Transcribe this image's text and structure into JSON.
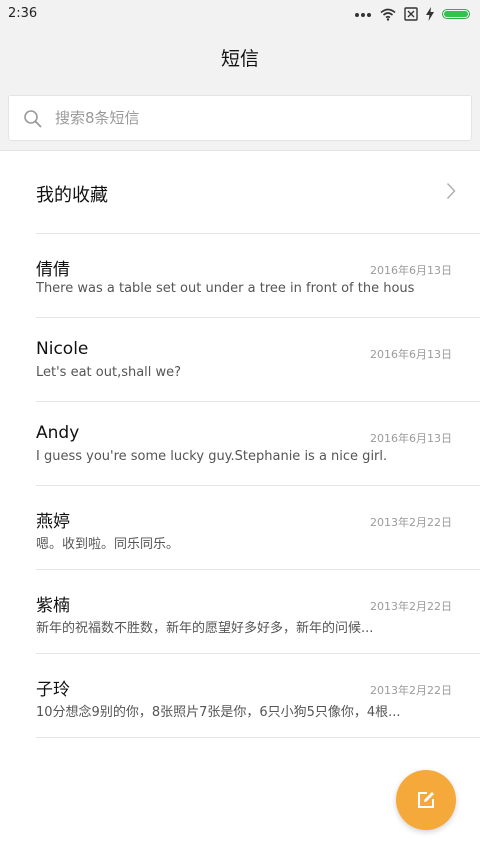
{
  "status_bar": {
    "time": "2:36"
  },
  "header": {
    "title": "短信"
  },
  "search": {
    "placeholder": "搜索8条短信"
  },
  "favorites": {
    "label": "我的收藏"
  },
  "conversations": [
    {
      "name": "倩倩",
      "date": "2016年6月13日",
      "preview": "There was a table set out under a tree in front of the hous"
    },
    {
      "name": "Nicole",
      "date": "2016年6月13日",
      "preview": "Let's eat out,shall we?"
    },
    {
      "name": "Andy",
      "date": "2016年6月13日",
      "preview": "I guess you're some lucky guy.Stephanie is a nice girl."
    },
    {
      "name": "燕婷",
      "date": "2013年2月22日",
      "preview": "嗯。收到啦。同乐同乐。"
    },
    {
      "name": "紫楠",
      "date": "2013年2月22日",
      "preview": "新年的祝福数不胜数，新年的愿望好多好多，新年的问候..."
    },
    {
      "name": "子玲",
      "date": "2013年2月22日",
      "preview": "10分想念9别的你，8张照片7张是你，6只小狗5只像你，4根..."
    }
  ],
  "colors": {
    "accent": "#f5a93a",
    "battery": "#33c24f"
  },
  "icons": {
    "search": "search-icon",
    "chevron": "chevron-right-icon",
    "compose": "compose-icon"
  }
}
